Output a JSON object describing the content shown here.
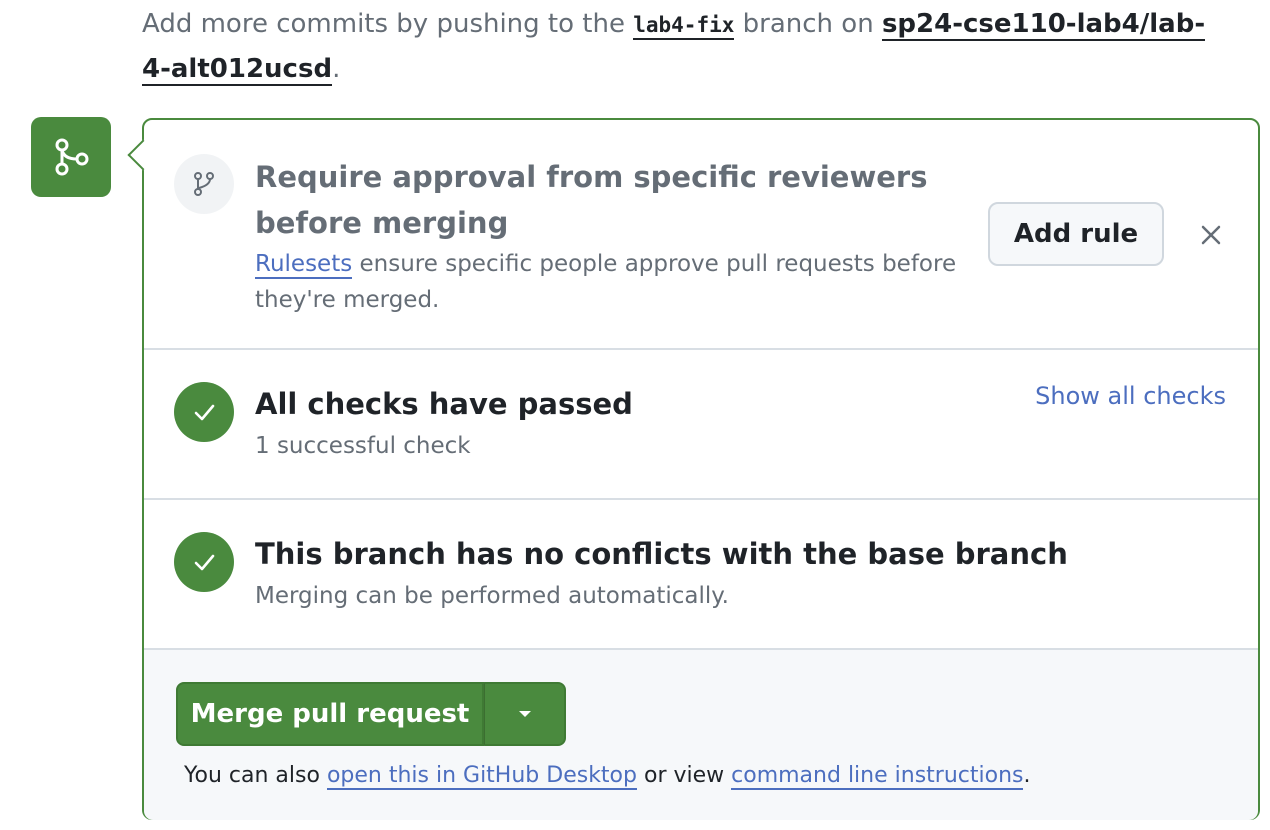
{
  "hint": {
    "prefix": "Add more commits by pushing to the ",
    "branch": "lab4-fix",
    "middle": " branch on ",
    "repo": "sp24-cse110-lab4/lab-4-alt012ucsd",
    "suffix": "."
  },
  "rule_section": {
    "title": "Require approval from specific reviewers before merging",
    "link_text": "Rulesets",
    "description": " ensure specific people approve pull requests before they're merged.",
    "add_rule_label": "Add rule"
  },
  "checks_section": {
    "title": "All checks have passed",
    "subtitle": "1 successful check",
    "show_all_label": "Show all checks"
  },
  "conflicts_section": {
    "title": "This branch has no conflicts with the base branch",
    "subtitle": "Merging can be performed automatically."
  },
  "merge_section": {
    "merge_label": "Merge pull request",
    "also_prefix": "You can also ",
    "desktop_link": "open this in GitHub Desktop",
    "also_middle": " or view ",
    "cli_link": "command line instructions",
    "also_suffix": "."
  },
  "icons": {
    "badge": "git-merge-icon",
    "rule": "branch-icon",
    "check": "check-icon",
    "close": "close-icon",
    "dropdown": "caret-down-icon"
  },
  "colors": {
    "success_green": "#4a8a3e",
    "link_blue": "#4c6ebf",
    "muted_text": "#656d76"
  }
}
